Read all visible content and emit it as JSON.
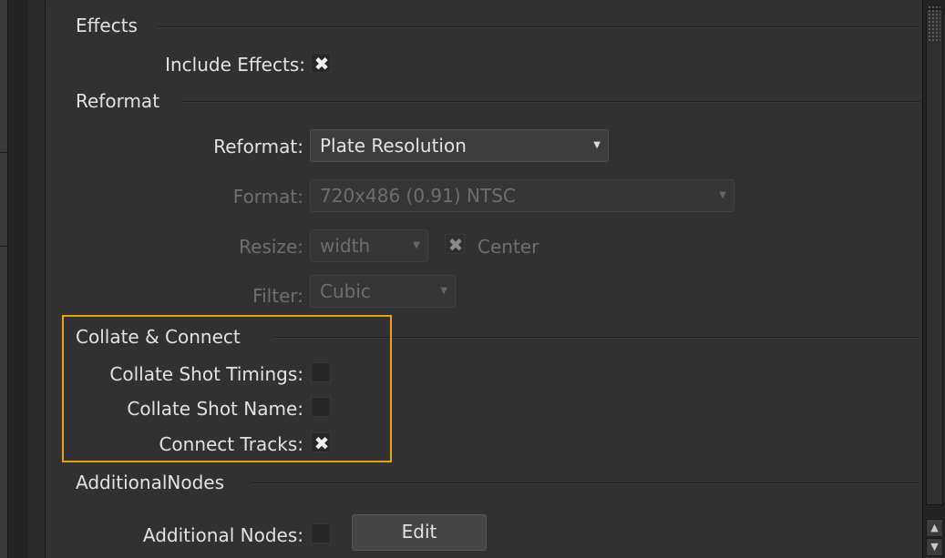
{
  "colors": {
    "highlight": "#e4a317",
    "panel": "#313131",
    "text": "#e2e2e2",
    "disabled_text": "#6f6f6f"
  },
  "effects": {
    "title": "Effects",
    "include_effects_label": "Include Effects:",
    "include_effects_checked": true
  },
  "reformat": {
    "title": "Reformat",
    "reformat_label": "Reformat:",
    "reformat_value": "Plate Resolution",
    "format_label": "Format:",
    "format_value": "720x486 (0.91) NTSC",
    "resize_label": "Resize:",
    "resize_value": "width",
    "center_label": "Center",
    "center_checked": true,
    "filter_label": "Filter:",
    "filter_value": "Cubic"
  },
  "collate": {
    "title": "Collate & Connect",
    "timings_label": "Collate Shot Timings:",
    "timings_checked": false,
    "name_label": "Collate Shot Name:",
    "name_checked": false,
    "tracks_label": "Connect Tracks:",
    "tracks_checked": true
  },
  "additional": {
    "title": "AdditionalNodes",
    "nodes_label": "Additional Nodes:",
    "nodes_checked": false,
    "edit_label": "Edit"
  },
  "icons": {
    "check": "✖",
    "dropdown": "▼",
    "scroll_up": "▲",
    "scroll_down": "▼"
  }
}
